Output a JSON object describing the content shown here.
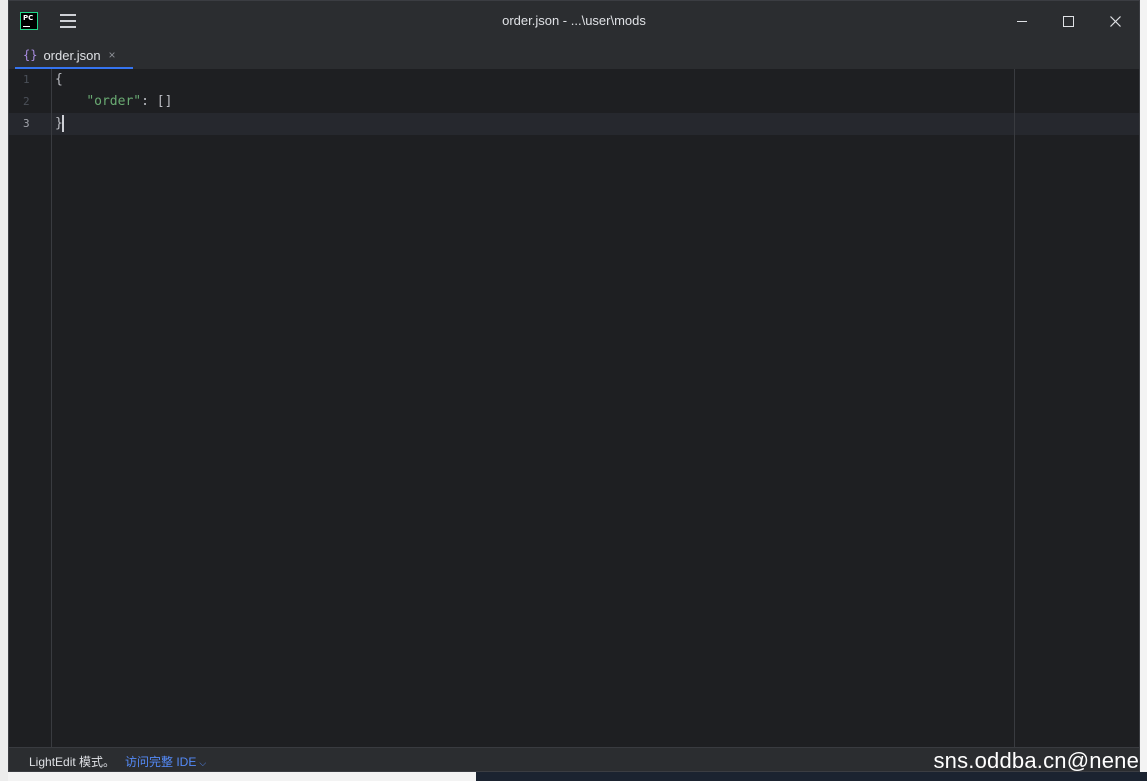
{
  "titlebar": {
    "app_icon_text": "PC",
    "title": "order.json - ...\\user\\mods"
  },
  "tabs": [
    {
      "icon": "{}",
      "label": "order.json",
      "close": "×"
    }
  ],
  "editor": {
    "lines": [
      {
        "number": "1",
        "text": "{"
      },
      {
        "number": "2",
        "indent": "    ",
        "key": "\"order\"",
        "rest": ": []"
      },
      {
        "number": "3",
        "text": "}"
      }
    ],
    "current_line": "3"
  },
  "statusbar": {
    "mode": "LightEdit 模式。",
    "link": "访问完整 IDE",
    "link_chevron": "⌵"
  },
  "watermark": "sns.oddba.cn@nene",
  "colors": {
    "editor_bg": "#1e1f22",
    "chrome_bg": "#2b2d30",
    "accent": "#3574f0",
    "string_key": "#6aab73",
    "link": "#548af7"
  }
}
